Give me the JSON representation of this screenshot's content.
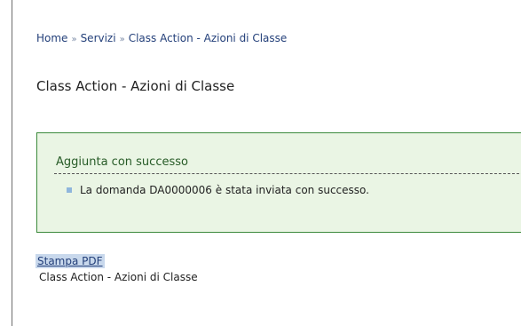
{
  "breadcrumb": {
    "items": [
      "Home",
      "Servizi",
      "Class Action - Azioni di Classe"
    ],
    "separator": "»"
  },
  "page": {
    "title": "Class Action - Azioni di Classe"
  },
  "message": {
    "title": "Aggiunta con successo",
    "items": [
      "La domanda DA0000006 è stata inviata con successo."
    ],
    "colors": {
      "background": "#eaf5e4",
      "border": "#3c8a3c",
      "title": "#275b27",
      "bullet": "#8fb6dc"
    }
  },
  "actions": {
    "pdf_label": "Stampa PDF",
    "pdf_caption": "Class Action - Azioni di Classe"
  }
}
